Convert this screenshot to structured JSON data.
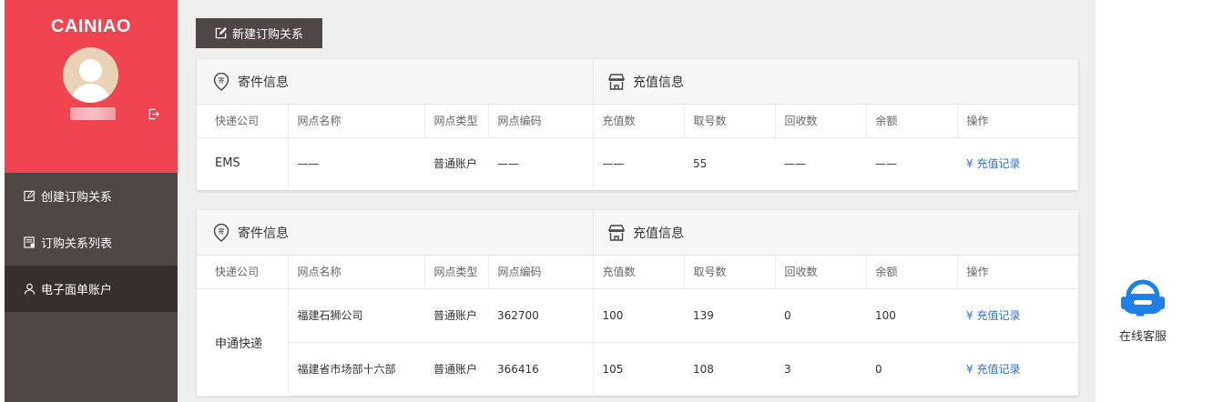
{
  "brand": "CAINIAO",
  "sidebar": {
    "items": [
      {
        "label": "创建订购关系"
      },
      {
        "label": "订购关系列表"
      },
      {
        "label": "电子面单账户"
      }
    ]
  },
  "toolbar": {
    "new_label": "新建订购关系"
  },
  "sections": {
    "sender_title": "寄件信息",
    "recharge_title": "充值信息"
  },
  "table": {
    "headers": [
      "快递公司",
      "网点名称",
      "网点类型",
      "网点编码",
      "充值数",
      "取号数",
      "回收数",
      "余额",
      "操作"
    ]
  },
  "card1": {
    "company": "EMS",
    "rows": [
      {
        "name": "——",
        "type": "普通账户",
        "code": "——",
        "recharge": "——",
        "taken": "55",
        "recycled": "——",
        "balance": "——",
        "action": "¥ 充值记录"
      }
    ]
  },
  "card2": {
    "company": "申通快递",
    "rows": [
      {
        "name": "福建石狮公司",
        "type": "普通账户",
        "code": "362700",
        "recharge": "100",
        "taken": "139",
        "recycled": "0",
        "balance": "100",
        "action": "¥ 充值记录"
      },
      {
        "name": "福建省市场部十六部",
        "type": "普通账户",
        "code": "366416",
        "recharge": "105",
        "taken": "108",
        "recycled": "3",
        "balance": "0",
        "action": "¥ 充值记录"
      }
    ]
  },
  "support": {
    "label": "在线客服"
  },
  "colors": {
    "brand_red": "#f0454f",
    "sidebar_dark": "#4f4646",
    "sidebar_active": "#352f2f",
    "link_blue": "#2f73c9",
    "support_blue": "#1e7fe6"
  }
}
